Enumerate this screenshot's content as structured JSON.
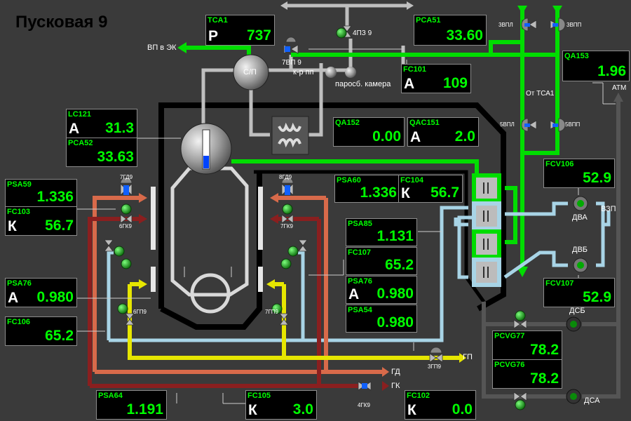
{
  "title": "Пусковая 9",
  "instruments": [
    {
      "id": "tca1",
      "tag": "TCA1",
      "mode": "Р",
      "value": "737"
    },
    {
      "id": "pca51",
      "tag": "PCA51",
      "mode": "",
      "value": "33.60"
    },
    {
      "id": "fc101",
      "tag": "FC101",
      "mode": "А",
      "value": "109"
    },
    {
      "id": "qa153",
      "tag": "QA153",
      "mode": "",
      "value": "1.96"
    },
    {
      "id": "lc121",
      "tag": "LC121",
      "mode": "А",
      "value": "31.3"
    },
    {
      "id": "pca52",
      "tag": "PCA52",
      "mode": "",
      "value": "33.63"
    },
    {
      "id": "qa152",
      "tag": "QA152",
      "mode": "",
      "value": "0.00"
    },
    {
      "id": "qac151",
      "tag": "QAC151",
      "mode": "А",
      "value": "2.0"
    },
    {
      "id": "psa59",
      "tag": "PSA59",
      "mode": "",
      "value": "1.336"
    },
    {
      "id": "fc103",
      "tag": "FC103",
      "mode": "К",
      "value": "56.7"
    },
    {
      "id": "psa60",
      "tag": "PSA60",
      "mode": "",
      "value": "1.336"
    },
    {
      "id": "fc104",
      "tag": "FC104",
      "mode": "К",
      "value": "56.7"
    },
    {
      "id": "fcv106",
      "tag": "FCV106",
      "mode": "",
      "value": "52.9"
    },
    {
      "id": "psa85",
      "tag": "PSA85",
      "mode": "",
      "value": "1.131"
    },
    {
      "id": "fc107",
      "tag": "FC107",
      "mode": "",
      "value": "65.2"
    },
    {
      "id": "psa76r",
      "tag": "PSA76",
      "mode": "А",
      "value": "0.980"
    },
    {
      "id": "psa54",
      "tag": "PSA54",
      "mode": "",
      "value": "0.980"
    },
    {
      "id": "psa76l",
      "tag": "PSA76",
      "mode": "А",
      "value": "0.980"
    },
    {
      "id": "fc106",
      "tag": "FC106",
      "mode": "",
      "value": "65.2"
    },
    {
      "id": "fcv107",
      "tag": "FCV107",
      "mode": "",
      "value": "52.9"
    },
    {
      "id": "pcvg77",
      "tag": "PCVG77",
      "mode": "",
      "value": "78.2"
    },
    {
      "id": "pcvg76",
      "tag": "PCVG76",
      "mode": "",
      "value": "78.2"
    },
    {
      "id": "psa64",
      "tag": "PSA64",
      "mode": "",
      "value": "1.191"
    },
    {
      "id": "fc105",
      "tag": "FC105",
      "mode": "К",
      "value": "3.0"
    },
    {
      "id": "fc102",
      "tag": "FC102",
      "mode": "К",
      "value": "0.0"
    }
  ],
  "labels": {
    "vp_ek": "ВП в ЭК",
    "sp": "С/П",
    "v7vp9": "7ВП 9",
    "v4pz9": "4ПЗ 9",
    "krpp": "к-р пп",
    "parosb": "паросб. камера",
    "v3vpl": "3ВПЛ",
    "v3vpp": "3ВПП",
    "ot_tca1": "От ТСА1",
    "v5vpl": "5ВПЛ",
    "v5vpp": "5ВПП",
    "atm": "АТМ",
    "v7gd9": "7ГД9",
    "v6gk9": "6ГК9",
    "v8gd9": "8ГД9",
    "v7gk9": "7ГК9",
    "v6gp9": "6ГП9",
    "v7gp9": "7ГП9",
    "dva": "ДВА",
    "dvb": "ДВБ",
    "vzp": "ВЗП",
    "dsb": "ДСБ",
    "dsa": "ДСА",
    "gd": "ГД",
    "gk": "ГК",
    "gp": "ГП",
    "v3gp9": "3ГП9",
    "v4gk9": "4ГК9"
  }
}
